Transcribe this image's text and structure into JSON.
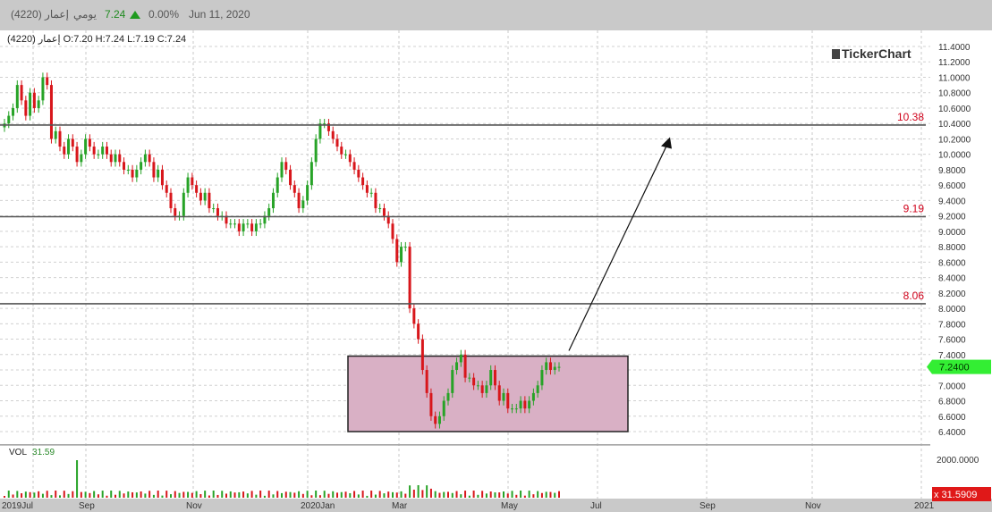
{
  "header": {
    "symbol": "إعمار (4220)",
    "period": "يومي",
    "last": "7.24",
    "change": "0.00%",
    "date": "Jun 11, 2020"
  },
  "ohlc_text": "إعمار (4220)  O:7.20  H:7.24  L:7.19  C:7.24",
  "brand": "TickerChart",
  "vol": {
    "label": "VOL",
    "value": "31.59"
  },
  "chart_data": {
    "type": "candlestick",
    "title": "",
    "xlabel": "",
    "ylabel": "",
    "ylim": [
      6.3,
      11.5
    ],
    "y_ticks": [
      "11.4000",
      "11.2000",
      "11.0000",
      "10.8000",
      "10.6000",
      "10.4000",
      "10.2000",
      "10.0000",
      "9.8000",
      "9.6000",
      "9.4000",
      "9.2000",
      "9.0000",
      "8.8000",
      "8.6000",
      "8.4000",
      "8.2000",
      "8.0000",
      "7.8000",
      "7.6000",
      "7.4000",
      "7.2000",
      "7.0000",
      "6.8000",
      "6.6000",
      "6.4000"
    ],
    "x_ticks": [
      "2019Jul",
      "Sep",
      "Nov",
      "2020Jan",
      "Mar",
      "May",
      "Jul",
      "Sep",
      "Nov",
      "2021"
    ],
    "horizontal_levels": [
      {
        "value": 10.38,
        "label": "10.38"
      },
      {
        "value": 9.19,
        "label": "9.19"
      },
      {
        "value": 8.06,
        "label": "8.06"
      }
    ],
    "range_box": {
      "low": 6.4,
      "high": 7.38
    },
    "arrow": {
      "from": 7.45,
      "to": 10.2
    },
    "last_price_label": "7.2400",
    "series_close_approx": [
      10.4,
      10.5,
      10.6,
      10.9,
      10.7,
      10.5,
      10.8,
      10.6,
      10.7,
      11.0,
      10.9,
      10.2,
      10.3,
      10.1,
      10.0,
      10.2,
      10.1,
      9.9,
      10.0,
      10.2,
      10.1,
      10.0,
      10.0,
      10.1,
      10.0,
      9.9,
      10.0,
      9.9,
      9.8,
      9.8,
      9.7,
      9.8,
      9.9,
      10.0,
      9.9,
      9.7,
      9.8,
      9.6,
      9.5,
      9.3,
      9.2,
      9.2,
      9.5,
      9.7,
      9.6,
      9.5,
      9.4,
      9.5,
      9.3,
      9.3,
      9.2,
      9.2,
      9.1,
      9.1,
      9.1,
      9.0,
      9.1,
      9.1,
      9.0,
      9.1,
      9.1,
      9.2,
      9.3,
      9.5,
      9.7,
      9.9,
      9.8,
      9.6,
      9.5,
      9.3,
      9.4,
      9.6,
      9.9,
      10.2,
      10.4,
      10.4,
      10.3,
      10.2,
      10.1,
      10.0,
      10.0,
      9.9,
      9.8,
      9.7,
      9.6,
      9.5,
      9.5,
      9.3,
      9.3,
      9.2,
      9.1,
      8.9,
      8.6,
      8.8,
      8.8,
      8.0,
      7.8,
      7.6,
      7.2,
      6.9,
      6.6,
      6.5,
      6.6,
      6.8,
      6.9,
      7.2,
      7.3,
      7.4,
      7.1,
      7.1,
      7.0,
      7.0,
      6.9,
      7.0,
      7.2,
      7.0,
      6.8,
      6.9,
      6.7,
      6.7,
      6.7,
      6.8,
      6.7,
      6.8,
      6.9,
      7.0,
      7.2,
      7.3,
      7.2,
      7.24,
      7.24
    ]
  },
  "volume_axis": {
    "tick": "2000.0000",
    "current": "31.5909",
    "current_prefix": "x"
  },
  "colors": {
    "up": "#27a327",
    "down": "#d8161b",
    "box_fill": "#d9b0c5",
    "level_label": "#d0021b",
    "price_tag": "#33ee33"
  }
}
